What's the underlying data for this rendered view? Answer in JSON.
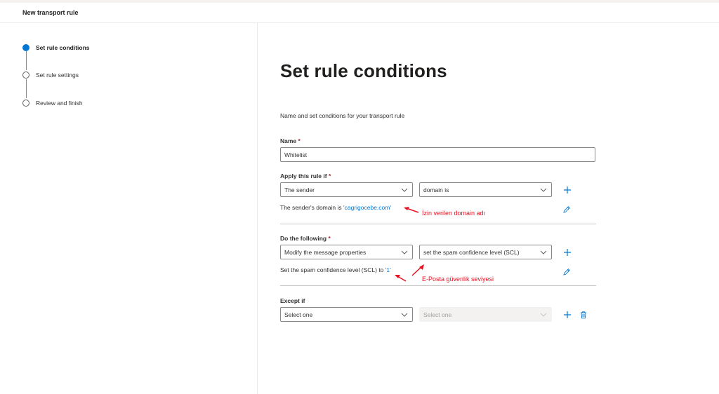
{
  "header": {
    "title": "New transport rule"
  },
  "steps": [
    {
      "label": "Set rule conditions",
      "state": "active"
    },
    {
      "label": "Set rule settings",
      "state": "pending"
    },
    {
      "label": "Review and finish",
      "state": "pending"
    }
  ],
  "main": {
    "title": "Set rule conditions",
    "description": "Name and set conditions for your transport rule"
  },
  "name_field": {
    "label": "Name",
    "required": "*",
    "value": "Whitelist"
  },
  "apply_section": {
    "label": "Apply this rule if",
    "required": "*",
    "dropdown1": "The sender",
    "dropdown2": "domain is",
    "summary_prefix": "The sender's domain is",
    "summary_value": "'cagrigocebe.com'"
  },
  "do_section": {
    "label": "Do the following",
    "required": "*",
    "dropdown1": "Modify the message properties",
    "dropdown2": "set the spam confidence level (SCL)",
    "summary_prefix": "Set the spam confidence level (SCL) to",
    "summary_value": "'1'"
  },
  "except_section": {
    "label": "Except if",
    "dropdown1": "Select one",
    "dropdown2": "Select one"
  },
  "annotations": {
    "domain_note": "İzin verilen domain adı",
    "scl_note": "E-Posta güvenlik seviyesi"
  },
  "colors": {
    "accent": "#0078d4",
    "annotation": "#e81123",
    "required": "#a4262c"
  },
  "icons": [
    "add-icon",
    "edit-icon",
    "delete-icon",
    "chevron-down-icon"
  ]
}
